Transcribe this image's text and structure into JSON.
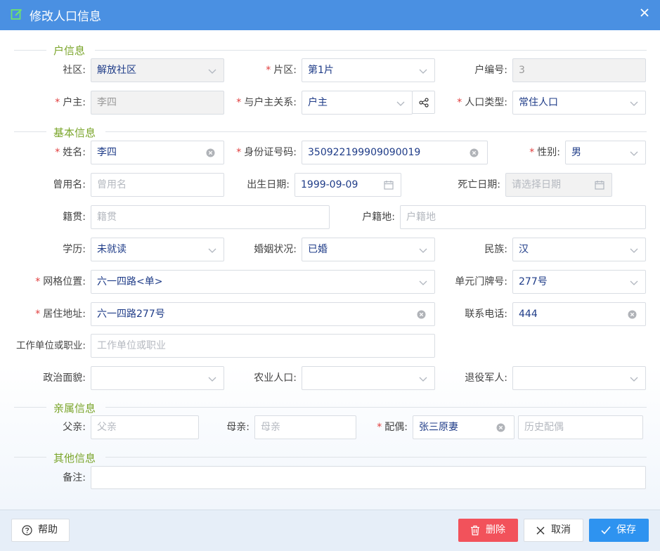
{
  "dialog": {
    "title": "修改人口信息"
  },
  "sections": {
    "household": "户信息",
    "basic": "基本信息",
    "relatives": "亲属信息",
    "other": "其他信息"
  },
  "fields": {
    "community": {
      "label": "社区:",
      "value": "解放社区"
    },
    "area": {
      "label": "片区:",
      "value": "第1片"
    },
    "household_no": {
      "label": "户编号:",
      "value": "3"
    },
    "householder": {
      "label": "户主:",
      "value": "李四"
    },
    "relation": {
      "label": "与户主关系:",
      "value": "户主"
    },
    "pop_type": {
      "label": "人口类型:",
      "value": "常住人口"
    },
    "name": {
      "label": "姓名:",
      "value": "李四"
    },
    "id_no": {
      "label": "身份证号码:",
      "value": "350922199909090019"
    },
    "gender": {
      "label": "性别:",
      "value": "男"
    },
    "former_name": {
      "label": "曾用名:",
      "placeholder": "曾用名"
    },
    "birth_date": {
      "label": "出生日期:",
      "value": "1999-09-09"
    },
    "death_date": {
      "label": "死亡日期:",
      "placeholder": "请选择日期"
    },
    "native_place": {
      "label": "籍贯:",
      "placeholder": "籍贯"
    },
    "domicile": {
      "label": "户籍地:",
      "placeholder": "户籍地"
    },
    "education": {
      "label": "学历:",
      "value": "未就读"
    },
    "marital": {
      "label": "婚姻状况:",
      "value": "已婚"
    },
    "ethnic": {
      "label": "民族:",
      "value": "汉"
    },
    "grid": {
      "label": "网格位置:",
      "value": "六一四路<单>"
    },
    "door_no": {
      "label": "单元门牌号:",
      "value": "277号"
    },
    "address": {
      "label": "居住地址:",
      "value": "六一四路277号"
    },
    "phone": {
      "label": "联系电话:",
      "value": "444"
    },
    "work": {
      "label": "工作单位或职业:",
      "placeholder": "工作单位或职业"
    },
    "political": {
      "label": "政治面貌:",
      "value": ""
    },
    "agri": {
      "label": "农业人口:",
      "value": ""
    },
    "veteran": {
      "label": "退役军人:",
      "value": ""
    },
    "father": {
      "label": "父亲:",
      "placeholder": "父亲"
    },
    "mother": {
      "label": "母亲:",
      "placeholder": "母亲"
    },
    "spouse": {
      "label": "配偶:",
      "value": "张三原妻"
    },
    "history_spouse": {
      "placeholder": "历史配偶"
    },
    "remark": {
      "label": "备注:",
      "value": ""
    }
  },
  "required_mark": "*",
  "buttons": {
    "help": "帮助",
    "delete": "删除",
    "cancel": "取消",
    "save": "保存"
  },
  "colors": {
    "titlebar": "#4a90e2",
    "section_title": "#7aa52a",
    "required": "#e03c3c",
    "delete": "#f2525b",
    "save": "#2e93f0",
    "value_text": "#1f3c88"
  }
}
